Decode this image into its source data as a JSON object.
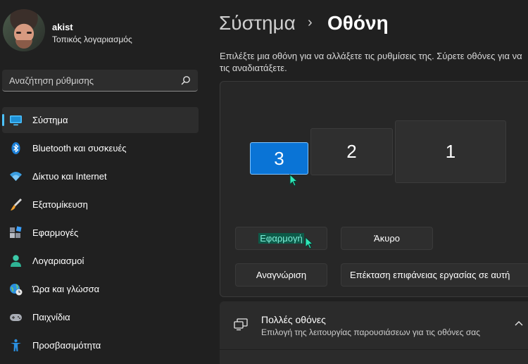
{
  "profile": {
    "name": "akist",
    "account_type": "Τοπικός λογαριασμός"
  },
  "search": {
    "placeholder": "Αναζήτηση ρύθμισης"
  },
  "sidebar": {
    "items": [
      {
        "label": "Σύστημα",
        "icon": "monitor-icon",
        "active": true
      },
      {
        "label": "Bluetooth και συσκευές",
        "icon": "bluetooth-icon"
      },
      {
        "label": "Δίκτυο και Internet",
        "icon": "wifi-icon"
      },
      {
        "label": "Εξατομίκευση",
        "icon": "brush-icon"
      },
      {
        "label": "Εφαρμογές",
        "icon": "apps-icon"
      },
      {
        "label": "Λογαριασμοί",
        "icon": "person-icon"
      },
      {
        "label": "Ώρα και γλώσσα",
        "icon": "globe-clock-icon"
      },
      {
        "label": "Παιχνίδια",
        "icon": "gamepad-icon"
      },
      {
        "label": "Προσβασιμότητα",
        "icon": "accessibility-icon"
      }
    ]
  },
  "header": {
    "breadcrumb_root": "Σύστημα",
    "separator": "›",
    "page_title": "Οθόνη"
  },
  "arrangement": {
    "description": "Επιλέξτε μια οθόνη για να αλλάξετε τις ρυθμίσεις της. Σύρετε οθόνες για να τις αναδιατάξετε.",
    "monitors": [
      {
        "number": "3",
        "selected": true
      },
      {
        "number": "2",
        "selected": false
      },
      {
        "number": "1",
        "selected": false
      }
    ],
    "apply_label": "Εφαρμογή",
    "cancel_label": "Άκυρο",
    "identify_label": "Αναγνώριση",
    "mode_value": "Επέκταση επιφάνειας εργασίας σε αυτή"
  },
  "multiple_displays": {
    "title": "Πολλές οθόνες",
    "subtitle": "Επιλογή της λειτουργίας παρουσιάσεων για τις οθόνες σας"
  },
  "colors": {
    "accent": "#4cc2ff",
    "selected_monitor": "#0a74d6",
    "background": "#202020"
  }
}
